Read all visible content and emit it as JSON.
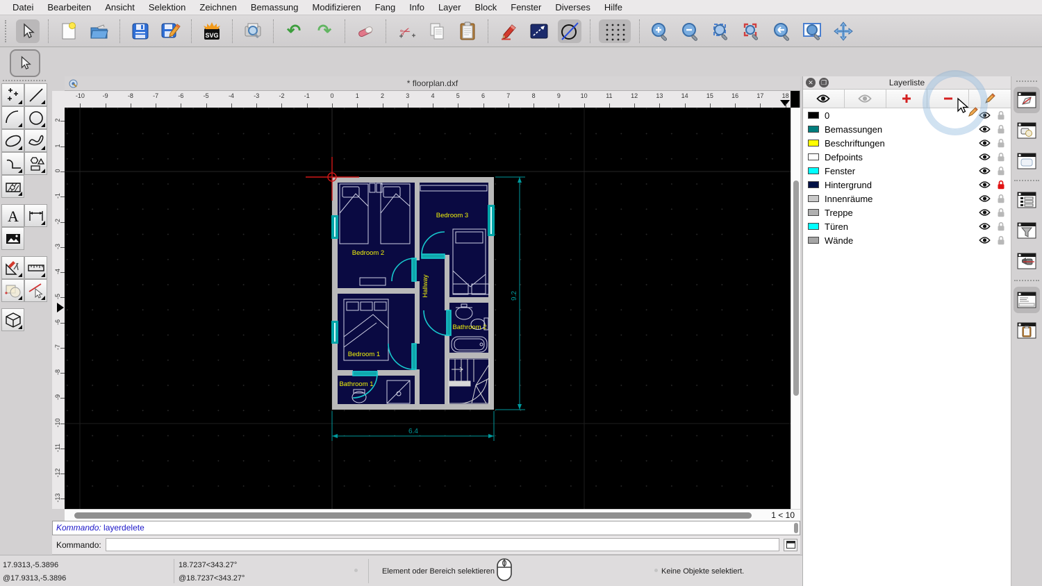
{
  "menu": {
    "items": [
      "Datei",
      "Bearbeiten",
      "Ansicht",
      "Selektion",
      "Zeichnen",
      "Bemassung",
      "Modifizieren",
      "Fang",
      "Info",
      "Layer",
      "Block",
      "Fenster",
      "Diverses",
      "Hilfe"
    ]
  },
  "toolbar": {
    "svg_label": "SVG"
  },
  "document": {
    "title": "* floorplan.dxf",
    "hruler": [
      -10,
      -9,
      -8,
      -7,
      -6,
      -5,
      -4,
      -3,
      -2,
      -1,
      0,
      1,
      2,
      3,
      4,
      5,
      6,
      7,
      8,
      9,
      10,
      11,
      12,
      13,
      14,
      15,
      16,
      17,
      18
    ],
    "vruler": [
      2,
      1,
      0,
      -1,
      -2,
      -3,
      -4,
      -5,
      -6,
      -7,
      -8,
      -9,
      -10,
      -11,
      -12,
      -13
    ],
    "zoom_indicator": "1 < 10"
  },
  "plan": {
    "labels": {
      "bedroom2": "Bedroom 2",
      "bedroom3": "Bedroom 3",
      "bedroom1": "Bedroom 1",
      "bathroom1": "Bathroom 1",
      "bathroom2": "Bathroom 2",
      "hallway": "Hallway"
    },
    "dimensions": {
      "height": "9.2",
      "width": "6.4"
    },
    "colors": {
      "wall": "#b9b9b9",
      "room_fill": "#0a0a42",
      "label": "#f2f20a",
      "door": "#17c8ce",
      "window": "#00a5a8",
      "dimension": "#00999c",
      "furniture": "#cfd0e4",
      "marker": "#d01818"
    }
  },
  "command": {
    "history_label": "Kommando:",
    "history_value": "layerdelete",
    "prompt_label": "Kommando:",
    "input_value": ""
  },
  "statusbar": {
    "abs_coords": "17.9313,-5.3896",
    "rel_coords": "@17.9313,-5.3896",
    "abs_polar": "18.7237<343.27°",
    "rel_polar": "@18.7237<343.27°",
    "hint": "Element oder Bereich selektieren",
    "selection_status": "Keine Objekte selektiert."
  },
  "layer_panel": {
    "title": "Layerliste",
    "layers": [
      {
        "name": "0",
        "color": "#000000",
        "locked": false
      },
      {
        "name": "Bemassungen",
        "color": "#007d7d",
        "locked": false
      },
      {
        "name": "Beschriftungen",
        "color": "#ffff00",
        "locked": false
      },
      {
        "name": "Defpoints",
        "color": "#ffffff",
        "locked": false
      },
      {
        "name": "Fenster",
        "color": "#00ffff",
        "locked": false
      },
      {
        "name": "Hintergrund",
        "color": "#001045",
        "locked": true
      },
      {
        "name": "Innenräume",
        "color": "#c9c9c9",
        "locked": false
      },
      {
        "name": "Treppe",
        "color": "#b0b0b0",
        "locked": false
      },
      {
        "name": "Türen",
        "color": "#00ffff",
        "locked": false
      },
      {
        "name": "Wände",
        "color": "#a5a5a5",
        "locked": false
      }
    ]
  }
}
